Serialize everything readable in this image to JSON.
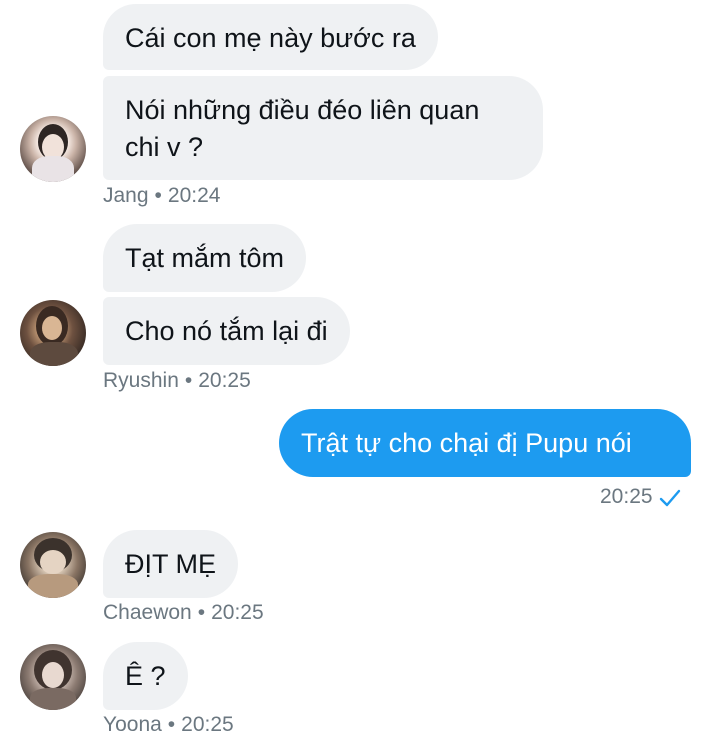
{
  "messages": [
    {
      "sender": "Jang",
      "time": "20:24",
      "bubbles": [
        "Cái con mẹ này bước ra",
        "Nói những điều đéo liên quan chi v ?"
      ]
    },
    {
      "sender": "Ryushin",
      "time": "20:25",
      "bubbles": [
        "Tạt mắm tôm",
        "Cho nó tắm lại đi"
      ]
    },
    {
      "sender": "me",
      "time": "20:25",
      "bubbles": [
        "Trật tự cho chại đị Pupu nói"
      ],
      "status": "sent-check-icon"
    },
    {
      "sender": "Chaewon",
      "time": "20:25",
      "bubbles": [
        "ĐỊT MẸ"
      ]
    },
    {
      "sender": "Yoona",
      "time": "20:25",
      "bubbles": [
        "Ê ?"
      ]
    }
  ],
  "colors": {
    "incoming_bubble": "#eff1f3",
    "outgoing_bubble": "#1d9bf0",
    "meta_text": "#6b7780"
  }
}
